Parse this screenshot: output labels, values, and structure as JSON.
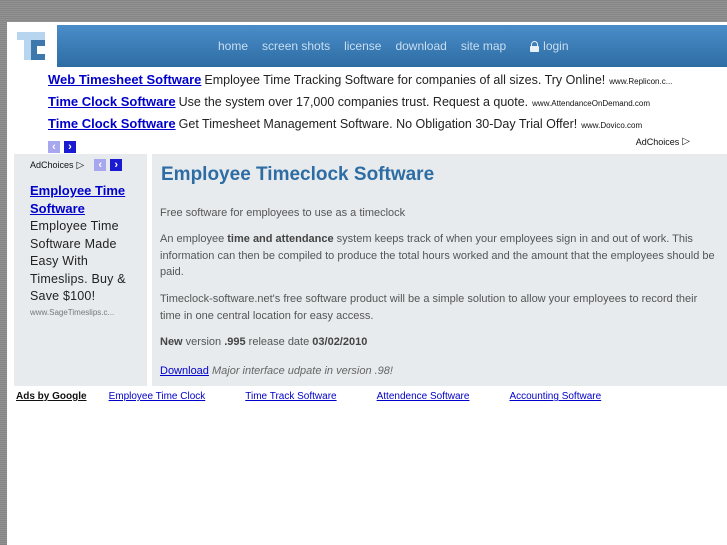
{
  "header": {
    "logo_alt": "TC",
    "nav": [
      {
        "label": "home"
      },
      {
        "label": "screen shots"
      },
      {
        "label": "license"
      },
      {
        "label": "download"
      },
      {
        "label": "site map"
      }
    ],
    "login_label": "login",
    "colors": {
      "nav_bg": "#3a7cb8",
      "nav_text": "#c9def1"
    }
  },
  "top_ads": [
    {
      "title": "Web Timesheet Software",
      "desc": "Employee Time Tracking Software for companies of all sizes. Try Online!",
      "url": "www.Replicon.c..."
    },
    {
      "title": "Time Clock Software",
      "desc": "Use the system over 17,000 companies trust. Request a quote.",
      "url": "www.AttendanceOnDemand.com"
    },
    {
      "title": "Time Clock Software",
      "desc": "Get Timesheet Management Software. No Obligation 30-Day Trial Offer!",
      "url": "www.Dovico.com"
    }
  ],
  "adchoices_label": "AdChoices",
  "arrows": {
    "prev": "‹",
    "next": "›"
  },
  "sidebar_ad": {
    "adchoices_label": "AdChoices",
    "title": "Employee Time Software",
    "desc": "Employee Time Software Made Easy With Timeslips. Buy & Save $100!",
    "url": "www.SageTimeslips.c..."
  },
  "main": {
    "title": "Employee Timeclock Software",
    "subtitle": "Free software for employees to use as a timeclock",
    "para1_pre": "An employee ",
    "para1_bold": "time and attendance",
    "para1_post": " system keeps track of when your employees sign in and out of work. This information can then be compiled to produce the total hours worked and the amount that the employees should be paid.",
    "para2": "Timeclock-software.net's free software product will be a simple solution to allow your employees to record their time in one central location for easy access.",
    "version": {
      "new_label": "New",
      "version_text": " version ",
      "version_num": ".995",
      "release_text": " release date ",
      "release_date": "03/02/2010"
    },
    "download_link": "Download",
    "download_note": "Major interface udpate in version .98!",
    "colors": {
      "title": "#2e6da4",
      "panel_bg": "#e7ebee"
    }
  },
  "bottom_ads": {
    "label": "Ads by Google",
    "links": [
      "Employee Time Clock",
      "Time Track Software",
      "Attendence Software",
      "Accounting Software"
    ]
  }
}
